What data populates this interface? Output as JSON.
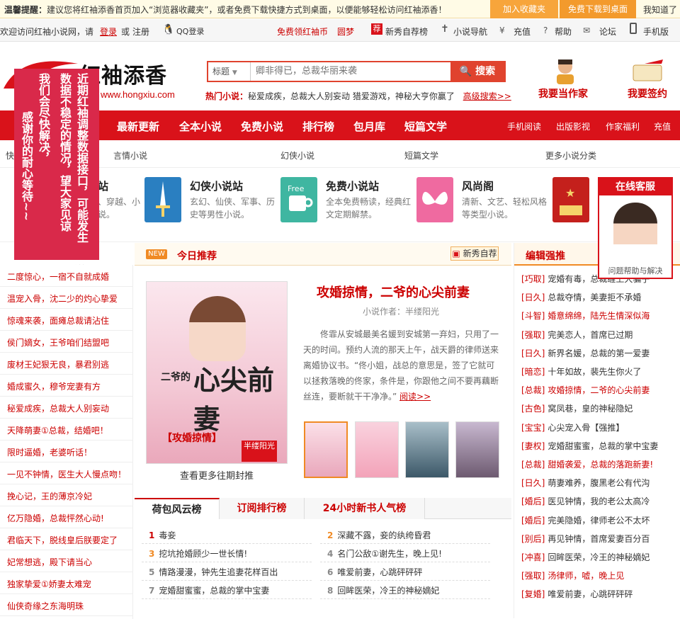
{
  "notice": {
    "label": "温馨提醒：",
    "text": "建议您将红袖添香首页加入“浏览器收藏夹”，或者免费下载快捷方式到桌面，以便能够轻松访问红袖添香！",
    "add_fav": "加入收藏夹",
    "download": "免费下载到桌面",
    "ok": "我知道了"
  },
  "topbar": {
    "welcome": "欢迎访问红袖小说网，请",
    "login": "登录",
    "or": "或",
    "register": "注册",
    "qq": "QQ登录",
    "free_coin": "免费领红袖币",
    "yuanmeng": "圆梦",
    "newbie": "新秀自荐榜",
    "novel_nav": "小说导航",
    "recharge": "充值",
    "help": "帮助",
    "forum": "论坛",
    "mobile": "手机版"
  },
  "logo": {
    "name": "红袖添香",
    "url": "www.hongxiu.com"
  },
  "search": {
    "category": "标题",
    "placeholder": "卿非得已，总裁华丽来袭",
    "button": "搜索"
  },
  "hot": {
    "label": "热门小说：",
    "text": "秘爱成疾，总裁大人别妄动  猎爱游戏，神秘大亨你赢了",
    "advanced": "高级搜索>>"
  },
  "header_links": {
    "author": "我要当作家",
    "sign": "我要签约"
  },
  "nav": {
    "items": [
      "最新更新",
      "全本小说",
      "免费小说",
      "排行榜",
      "包月库",
      "短篇文学"
    ],
    "right": [
      "手机阅读",
      "出版影视",
      "作家福利",
      "充值"
    ]
  },
  "subnav": {
    "quick": "快",
    "items": [
      "言情小说",
      "幻侠小说",
      "短篇文学",
      "更多小说分类"
    ]
  },
  "channels": [
    {
      "title": "站",
      "desc": "、穿越、小说。"
    },
    {
      "title": "幻侠小说站",
      "desc": "玄幻、仙侠、军事、历史等男性小说。"
    },
    {
      "title": "免费小说站",
      "desc": "全本免费畅读，经典红文定期解禁。"
    },
    {
      "title": "风尚阁",
      "desc": "清新、文艺、轻松风格等类型小说。"
    }
  ],
  "sidebar_ad": {
    "cols": [
      "近期红袖调整数据接口，可能发生",
      "数据不稳定的情况，望大家见谅",
      "我们会尽快解决，",
      "感谢你的耐心等待~~"
    ],
    "close": "关闭"
  },
  "left_list": [
    "二度惊心，一宿不自就成婚",
    "温宠入骨，沈二少的灼心挚爱",
    "惊魂来袭，面瘫总裁请沾住",
    "侯门嫡女，王爷咱们结盟吧",
    "废材王妃狠无良，暴君别逃",
    "婚成蜜久，穆爷宠妻有方",
    "秘爱成疾，总裁大人别妄动",
    "天降萌妻①总裁，结婚吧！",
    "限时逼婚，老婆听话！",
    "一见不钟情，医生大人慢点吻！",
    "挽心记，王的薄京冷妃",
    "亿万隐婚，总裁怦然心动!",
    "君临天下，脱线皇后朕要定了",
    "妃常想逃，殿下请当心",
    "独家挚爱①娇妻太难宠",
    "仙侠奇缘之东海明珠"
  ],
  "today": {
    "new": "NEW",
    "title": "今日推荐",
    "newbie": "新秀自荐",
    "cover_title": "心尖前妻",
    "cover_prefix": "二爷的",
    "cover_sub": "【攻婚掠情】",
    "cover_author": "半缕阳光",
    "more": "查看更多往期封推",
    "book_title": "攻婚掠情，二爷的心尖前妻",
    "author": "小说作者：半缕阳光",
    "desc": "佟霏从安城最美名媛到安城第一弃妇，只用了一天的时间。预约人流的那天上午，战天爵的律师送来离婚协议书。“佟小姐，战总的意思是，签了它就可以拯救落晚的佟家，条件是，你跟他之间不要再藕断丝连，要断就干干净净。”",
    "read": "阅读>>"
  },
  "rank": {
    "tabs": [
      "荷包风云榜",
      "订阅排行榜",
      "24小时新书人气榜"
    ],
    "items": [
      {
        "n": "1",
        "t": "毒妾"
      },
      {
        "n": "2",
        "t": "深藏不露，妾的纨绔昏君"
      },
      {
        "n": "3",
        "t": "挖坑抢婚顾少一世长情!"
      },
      {
        "n": "4",
        "t": "名门公敌①谢先生，晚上见!"
      },
      {
        "n": "5",
        "t": "情路漫漫，钟先生追妻花样百出"
      },
      {
        "n": "6",
        "t": "唯爱前妻，心跳砰砰砰"
      },
      {
        "n": "7",
        "t": "宠婚甜蜜蜜，总裁的掌中宝妻"
      },
      {
        "n": "8",
        "t": "回眸医荣，冷王的神秘嫡妃"
      }
    ]
  },
  "editor": {
    "title": "编辑强推",
    "items": [
      {
        "tag": "[巧取]",
        "text": "宠婚有毒，总裁缠上大骗子",
        "hl": false
      },
      {
        "tag": "[日久]",
        "text": "总裁夺情，美妻拒不承婚",
        "hl": false
      },
      {
        "tag": "[斗智]",
        "text": "婚意绵绵，陆先生情深似海",
        "hl": true
      },
      {
        "tag": "[强取]",
        "text": "完美恋人，首席已过期",
        "hl": false
      },
      {
        "tag": "[日久]",
        "text": "新界名媛，总裁的第一爱妻",
        "hl": false
      },
      {
        "tag": "[暗恋]",
        "text": "十年如故，裴先生你火了",
        "hl": false
      },
      {
        "tag": "[总裁]",
        "text": "攻婚掠情，二爷的心尖前妻",
        "hl": true
      },
      {
        "tag": "[古色]",
        "text": "窝凤巷，皇的神秘隐妃",
        "hl": false
      },
      {
        "tag": "[宝宝]",
        "text": "心尖宠入骨【强推】",
        "hl": false
      },
      {
        "tag": "[妻权]",
        "text": "宠婚甜蜜蜜，总裁的掌中宝妻",
        "hl": false
      },
      {
        "tag": "[总裁]",
        "text": "甜婚袭爱，总裁的落跑新妻!",
        "hl": true
      },
      {
        "tag": "[日久]",
        "text": "萌妻难养，腹黑老公有代沟",
        "hl": false
      },
      {
        "tag": "[婚后]",
        "text": "医见钟情，我的老公太高冷",
        "hl": false
      },
      {
        "tag": "[婚后]",
        "text": "完美隐婚，律师老公不太坏",
        "hl": false
      },
      {
        "tag": "[别后]",
        "text": "再见钟情，首席爱妻百分百",
        "hl": false
      },
      {
        "tag": "[冲喜]",
        "text": "回眸医荣，冷王的神秘嫡妃",
        "hl": false
      },
      {
        "tag": "[强取]",
        "text": "汤律师，嘘，晚上见",
        "hl": true
      },
      {
        "tag": "[复婚]",
        "text": "唯爱前妻，心跳砰砰砰",
        "hl": false
      }
    ]
  },
  "kefu": {
    "title": "在线客服",
    "footer": "问题帮助与解决"
  }
}
